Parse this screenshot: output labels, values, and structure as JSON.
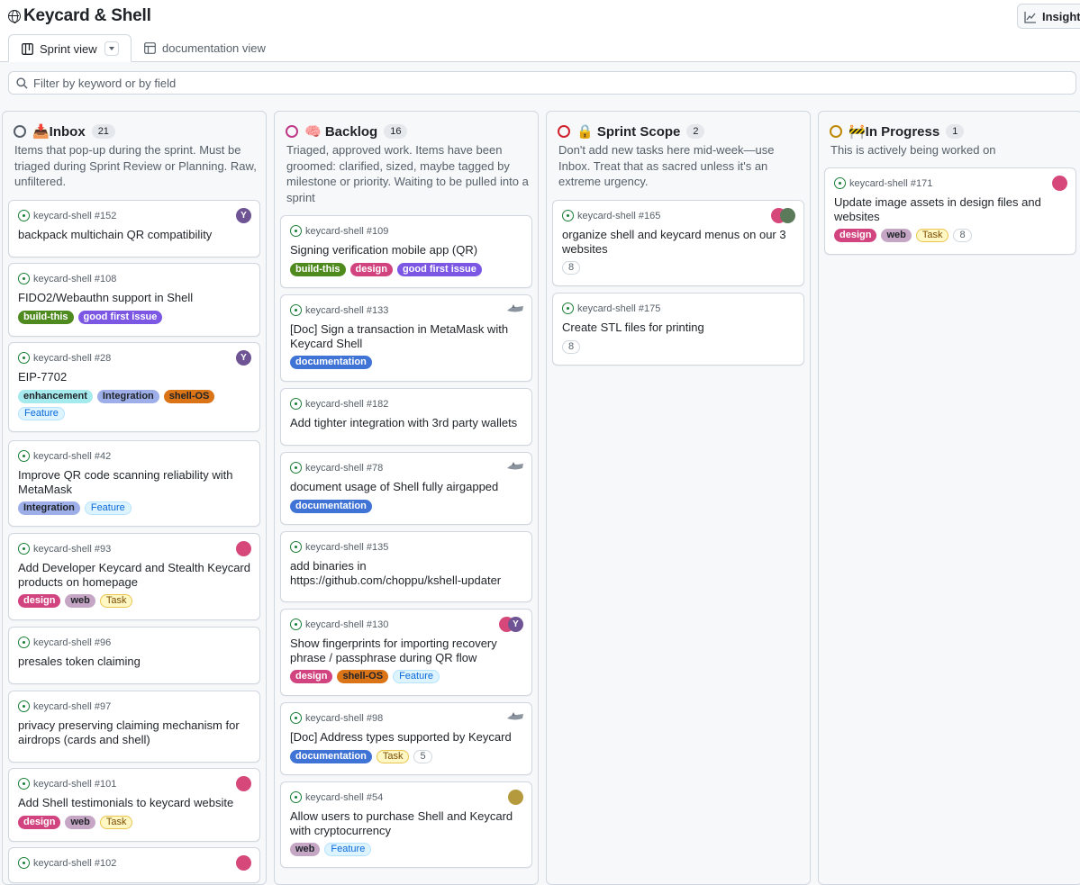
{
  "app": {
    "title": "Keycard & Shell",
    "insights_label": "Insights"
  },
  "views": {
    "active": "Sprint view",
    "other": "documentation view"
  },
  "filter": {
    "placeholder": "Filter by keyword or by field"
  },
  "colors": {
    "accent": "#0969da",
    "border": "#d0d7de",
    "open_issue": "#1a7f37"
  },
  "columns": [
    {
      "name": "📥Inbox",
      "count": "21",
      "status_color": "#57606a",
      "description": "Items that pop-up during the sprint. Must be triaged during Sprint Review or Planning. Raw, unfiltered.",
      "cards": [
        {
          "repo": "keycard-shell #152",
          "title": "backpack multichain QR compatibility",
          "labels": [],
          "avatar": "Y"
        },
        {
          "repo": "keycard-shell #108",
          "title": "FIDO2/Webauthn support in Shell",
          "labels": [
            "build-this",
            "good first issue"
          ],
          "avatar": ""
        },
        {
          "repo": "keycard-shell #28",
          "title": "EIP-7702",
          "labels": [
            "enhancement",
            "Integration",
            "shell-OS",
            "Feature"
          ],
          "avatar": "Y"
        },
        {
          "repo": "keycard-shell #42",
          "title": "Improve QR code scanning reliability with MetaMask",
          "labels": [
            "Integration",
            "Feature"
          ],
          "avatar": ""
        },
        {
          "repo": "keycard-shell #93",
          "title": "Add Developer Keycard and Stealth Keycard products on homepage",
          "labels": [
            "design",
            "web",
            "Task"
          ],
          "avatar": "pink"
        },
        {
          "repo": "keycard-shell #96",
          "title": "presales token claiming",
          "labels": [],
          "avatar": ""
        },
        {
          "repo": "keycard-shell #97",
          "title": "privacy preserving claiming mechanism for airdrops (cards and shell)",
          "labels": [],
          "avatar": ""
        },
        {
          "repo": "keycard-shell #101",
          "title": "Add Shell testimonials to keycard website",
          "labels": [
            "design",
            "web",
            "Task"
          ],
          "avatar": "pink"
        },
        {
          "repo": "keycard-shell #102",
          "title": "",
          "labels": [],
          "avatar": "pink"
        }
      ]
    },
    {
      "name": "🧠 Backlog",
      "count": "16",
      "status_color": "#bf3989",
      "description": "Triaged, approved work. Items have been groomed: clarified, sized, maybe tagged by milestone or priority. Waiting to be pulled into a sprint",
      "cards": [
        {
          "repo": "keycard-shell #109",
          "title": "Signing verification mobile app (QR)",
          "labels": [
            "build-this",
            "design",
            "good first issue"
          ],
          "avatar": ""
        },
        {
          "repo": "keycard-shell #133",
          "title": "[Doc] Sign a transaction in MetaMask with Keycard Shell",
          "labels": [
            "documentation"
          ],
          "avatar": "gray"
        },
        {
          "repo": "keycard-shell #182",
          "title": "Add tighter integration with 3rd party wallets",
          "labels": [],
          "avatar": ""
        },
        {
          "repo": "keycard-shell #78",
          "title": "document usage of Shell fully airgapped",
          "labels": [
            "documentation"
          ],
          "avatar": "gray"
        },
        {
          "repo": "keycard-shell #135",
          "title": "add binaries in https://github.com/choppu/kshell-updater",
          "labels": [],
          "avatar": ""
        },
        {
          "repo": "keycard-shell #130",
          "title": "Show fingerprints for importing recovery phrase / passphrase during QR flow",
          "labels": [
            "design",
            "shell-OS",
            "Feature"
          ],
          "avatar": "pinkY"
        },
        {
          "repo": "keycard-shell #98",
          "title": "[Doc] Address types supported by Keycard",
          "labels": [
            "documentation",
            "Task",
            "5"
          ],
          "avatar": "gray"
        },
        {
          "repo": "keycard-shell #54",
          "title": "Allow users to purchase Shell and Keycard with cryptocurrency",
          "labels": [
            "web",
            "Feature"
          ],
          "avatar": "gold"
        }
      ]
    },
    {
      "name": "🔒 Sprint Scope",
      "count": "2",
      "status_color": "#cf222e",
      "description": "Don't add new tasks here mid-week—use Inbox. Treat that as sacred unless it's an extreme urgency.",
      "cards": [
        {
          "repo": "keycard-shell #165",
          "title": "organize shell and keycard menus on our 3 websites",
          "labels": [
            "8"
          ],
          "avatar": "pair"
        },
        {
          "repo": "keycard-shell #175",
          "title": "Create STL files for printing",
          "labels": [
            "8"
          ],
          "avatar": ""
        }
      ]
    },
    {
      "name": "🚧In Progress",
      "count": "1",
      "status_color": "#bf8700",
      "description": "This is actively being worked on",
      "cards": [
        {
          "repo": "keycard-shell #171",
          "title": "Update image assets in design files and websites",
          "labels": [
            "design",
            "web",
            "Task",
            "8"
          ],
          "avatar": "pink"
        }
      ]
    }
  ]
}
